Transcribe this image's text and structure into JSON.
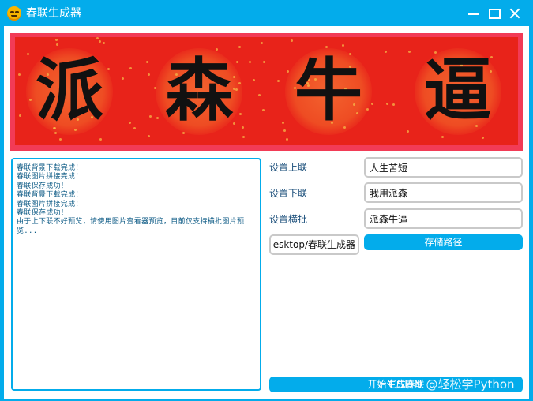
{
  "window": {
    "title": "春联生成器"
  },
  "banner": {
    "characters": [
      "派",
      "森",
      "牛",
      "逼"
    ]
  },
  "log": {
    "lines": [
      "春联背景下载完成！",
      "春联图片拼接完成！",
      "春联保存成功！",
      "春联背景下载完成！",
      "春联图片拼接完成！",
      "春联保存成功！",
      "由于上下联不好预览，请使用图片查看器预览，目前仅支持横批图片预览..."
    ]
  },
  "form": {
    "upper_label": "设置上联",
    "upper_value": "人生苦短",
    "lower_label": "设置下联",
    "lower_value": "我用派森",
    "horizontal_label": "设置横批",
    "horizontal_value": "派森牛逼",
    "path_value": "esktop/春联生成器",
    "save_path_label": "存储路径"
  },
  "actions": {
    "generate_label": "开始生成春联"
  },
  "watermark": "CSDN @轻松学Python",
  "colors": {
    "accent": "#03aceb",
    "banner_red": "#e8231a",
    "banner_border": "#f23b56"
  }
}
